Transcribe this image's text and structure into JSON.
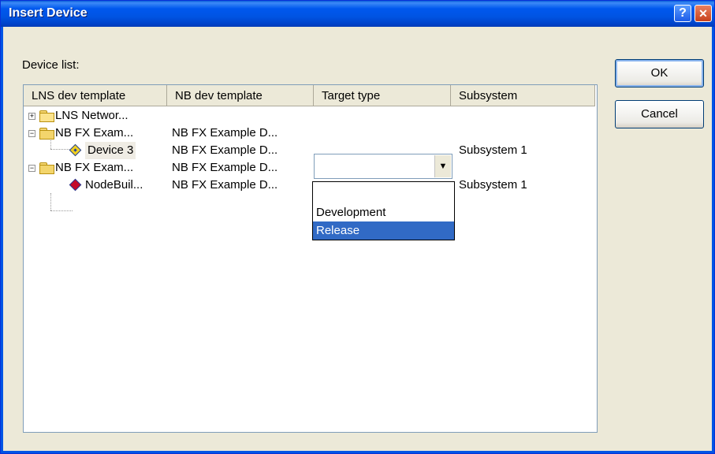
{
  "window": {
    "title": "Insert Device",
    "help_glyph": "?",
    "close_glyph": "✕"
  },
  "device_list_label": "Device list:",
  "columns": [
    "LNS dev template",
    "NB dev template",
    "Target type",
    "Subsystem"
  ],
  "rows": [
    {
      "expander": "+",
      "icon": "folder-icon",
      "name": "LNS Networ...",
      "nb": "",
      "target": "",
      "subsystem": ""
    },
    {
      "expander": "−",
      "icon": "folder-open-icon",
      "name": "NB FX Exam...",
      "nb": "NB FX Example D...",
      "target": "",
      "subsystem": ""
    },
    {
      "expander": "",
      "icon": "device-icon",
      "name": "Device 3",
      "nb": "NB FX Example D...",
      "target": "",
      "subsystem": "Subsystem 1"
    },
    {
      "expander": "−",
      "icon": "folder-open-icon",
      "name": "NB FX Exam...",
      "nb": "NB FX Example D...",
      "target": "",
      "subsystem": ""
    },
    {
      "expander": "",
      "icon": "nodebuilder-device-icon",
      "name": "NodeBuil...",
      "nb": "NB FX Example D...",
      "target": "",
      "subsystem": "Subsystem 1"
    }
  ],
  "combo": {
    "value": "",
    "arrow": "▼"
  },
  "dropdown_options": [
    {
      "label": "Development",
      "selected": false
    },
    {
      "label": "Release",
      "selected": true
    }
  ],
  "buttons": {
    "ok": "OK",
    "cancel": "Cancel"
  },
  "colors": {
    "title_bar": "#0054e3",
    "selection": "#316ac5",
    "dialog_bg": "#ece9d8"
  }
}
